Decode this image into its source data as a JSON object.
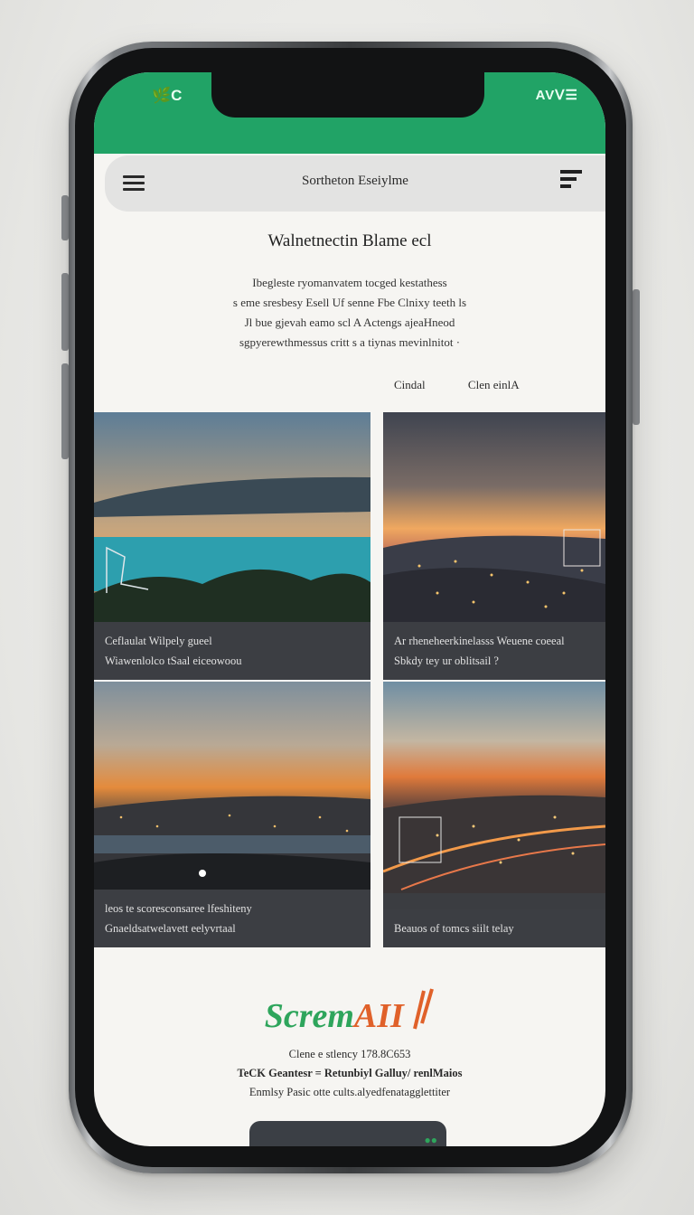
{
  "status_bar": {
    "left": "🌿C",
    "right": "AV⁠ᐯ☰"
  },
  "nav": {
    "title": "Sortheton Eseiylme"
  },
  "headline": "Walnetnectin Blame ecl",
  "intro": [
    "Ibegleste ryomanvatem tocged kestathess",
    "s eme sresbesy Esell Uf senne Fbe Clnixy teeth ls",
    "Jl bue gjevah eamo scl A Actengs ajeaHneod",
    "sgpyerewthmessus critt s a tiynas mevinlnitot ·"
  ],
  "links": [
    "Cindal",
    "Clen einlA"
  ],
  "cards": [
    {
      "line1": "Ceflaulat Wilpely gueel",
      "line2": "Wiawenlolco tSaal eiceowoou"
    },
    {
      "line1": "Ar rheneheerkinelasss Weuene coeeal",
      "line2": "Sbkdy tey ur oblitsail ?"
    },
    {
      "line1": "leos te scoresconsaree lfeshiteny",
      "line2": "Gnaeldsatwelavett eelyvrtaal"
    },
    {
      "line1": "Beauos of tomcs siilt telay",
      "line2": ""
    }
  ],
  "brand": {
    "green": "Screm",
    "orange": "AII"
  },
  "footer": [
    "Clene e stlency 178.8C653",
    "TeCK Geantesr = Retunbiyl Galluy/ renlMaios",
    "Enmlsy Pasic otte cults.alyedfenatagglettiter"
  ],
  "colors": {
    "status_green": "#21a366",
    "brand_green": "#2ea55c",
    "brand_orange": "#e0612a"
  }
}
